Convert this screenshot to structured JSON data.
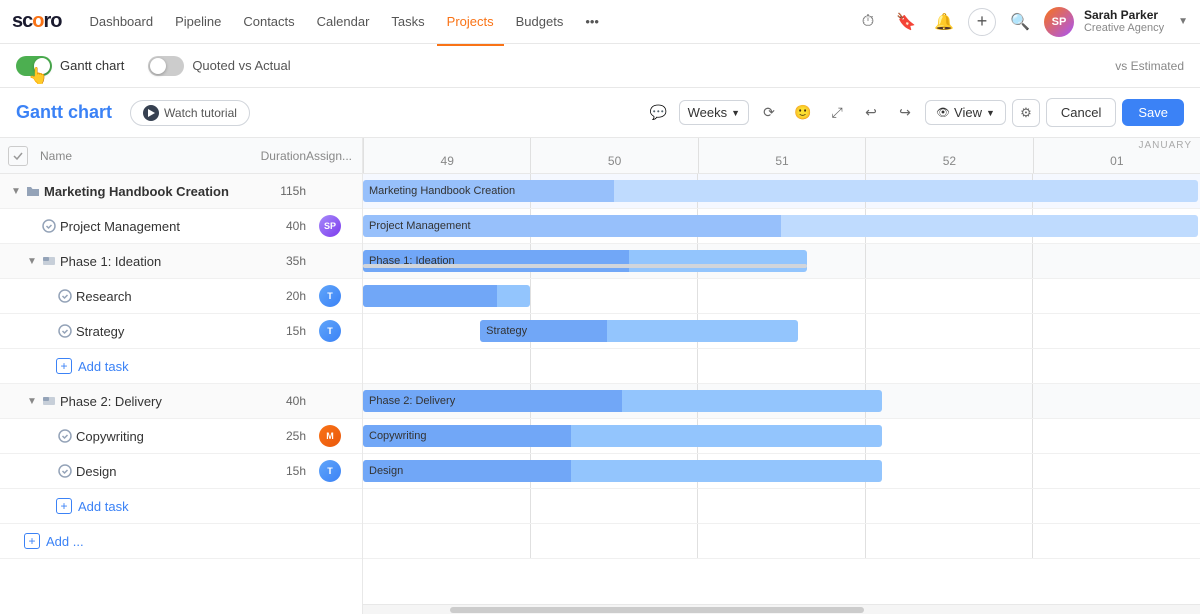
{
  "logo": {
    "text": "scoro"
  },
  "nav": {
    "items": [
      {
        "label": "Dashboard",
        "active": false
      },
      {
        "label": "Pipeline",
        "active": false
      },
      {
        "label": "Contacts",
        "active": false
      },
      {
        "label": "Calendar",
        "active": false
      },
      {
        "label": "Tasks",
        "active": false
      },
      {
        "label": "Projects",
        "active": true
      },
      {
        "label": "Budgets",
        "active": false
      }
    ],
    "more": "•••",
    "user": {
      "name": "Sarah Parker",
      "company": "Creative Agency",
      "initials": "SP"
    }
  },
  "subbar": {
    "gantt_chart_label": "Gantt chart",
    "quoted_actual_label": "Quoted vs Actual",
    "vs_estimated": "vs Estimated"
  },
  "gantt_header": {
    "title": "Gantt chart",
    "watch_tutorial": "Watch tutorial",
    "weeks_label": "Weeks",
    "view_label": "View",
    "cancel_label": "Cancel",
    "save_label": "Save"
  },
  "columns": {
    "name": "Name",
    "duration": "Duration",
    "assignee": "Assign..."
  },
  "weeks": {
    "month": "JANUARY",
    "nums": [
      "49",
      "50",
      "51",
      "52",
      "01"
    ]
  },
  "rows": [
    {
      "id": "marketing",
      "type": "group",
      "indent": 1,
      "name": "Marketing Handbook Creation",
      "duration": "115h",
      "has_avatar": false,
      "expanded": true
    },
    {
      "id": "project-management",
      "type": "task",
      "indent": 2,
      "name": "Project Management",
      "duration": "40h",
      "has_avatar": true,
      "avatar_color": "#a78bfa"
    },
    {
      "id": "phase1",
      "type": "phase",
      "indent": 2,
      "name": "Phase 1: Ideation",
      "duration": "35h",
      "has_avatar": false,
      "expanded": true
    },
    {
      "id": "research",
      "type": "task",
      "indent": 3,
      "name": "Research",
      "duration": "20h",
      "has_avatar": true,
      "avatar_color": "#6ea8fe"
    },
    {
      "id": "strategy",
      "type": "task",
      "indent": 3,
      "name": "Strategy",
      "duration": "15h",
      "has_avatar": true,
      "avatar_color": "#6ea8fe"
    },
    {
      "id": "add-task-phase1",
      "type": "add",
      "indent": 3,
      "name": "Add task"
    },
    {
      "id": "phase2",
      "type": "phase",
      "indent": 2,
      "name": "Phase 2: Delivery",
      "duration": "40h",
      "has_avatar": false,
      "expanded": true
    },
    {
      "id": "copywriting",
      "type": "task",
      "indent": 3,
      "name": "Copywriting",
      "duration": "25h",
      "has_avatar": true,
      "avatar_color": "#f97316"
    },
    {
      "id": "design",
      "type": "task",
      "indent": 3,
      "name": "Design",
      "duration": "15h",
      "has_avatar": true,
      "avatar_color": "#6ea8fe"
    },
    {
      "id": "add-task-phase2",
      "type": "add",
      "indent": 3,
      "name": "Add task"
    },
    {
      "id": "add-group",
      "type": "add-group",
      "indent": 1,
      "name": "Add ..."
    }
  ],
  "bars": {
    "marketing": {
      "left": "0%",
      "width": "100%",
      "color": "#bfdbfe",
      "label": "Marketing Handbook Creation",
      "progress": 30
    },
    "project-management": {
      "left": "0%",
      "width": "100%",
      "color": "#93c5fd",
      "label": "Project Management",
      "progress": 50
    },
    "phase1": {
      "left": "0%",
      "width": "53%",
      "color": "#93c5fd",
      "label": "Phase 1: Ideation",
      "progress": 60
    },
    "phase1-gray": {
      "left": "0%",
      "width": "53%",
      "show": true
    },
    "research": {
      "left": "0%",
      "width": "20%",
      "color": "#93c5fd",
      "label": "",
      "progress": 80
    },
    "strategy": {
      "left": "14%",
      "width": "39%",
      "color": "#93c5fd",
      "label": "Strategy",
      "progress": 40
    },
    "phase2": {
      "left": "0%",
      "width": "63%",
      "color": "#93c5fd",
      "label": "Phase 2: Delivery",
      "progress": 50
    },
    "copywriting": {
      "left": "0%",
      "width": "63%",
      "color": "#93c5fd",
      "label": "Copywriting",
      "progress": 40
    },
    "design": {
      "left": "0%",
      "width": "63%",
      "color": "#93c5fd",
      "label": "Design",
      "progress": 40
    }
  }
}
